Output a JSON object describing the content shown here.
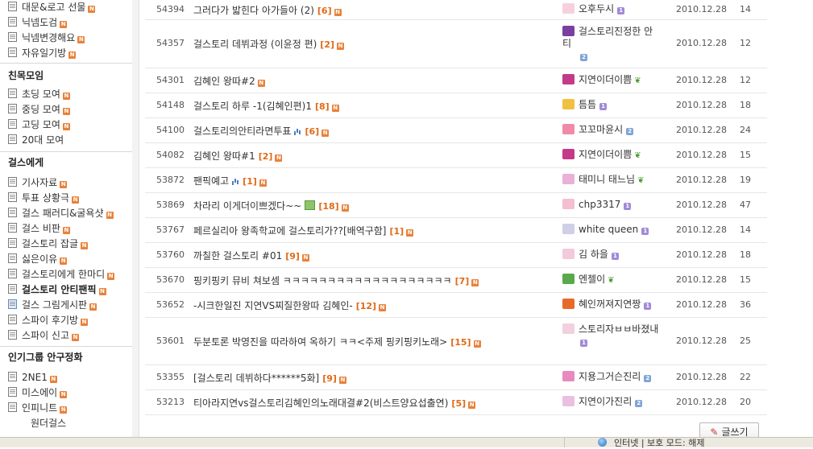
{
  "sidebar": {
    "group1_items": [
      {
        "label": "대문&로고 선물",
        "badge": "N"
      },
      {
        "label": "닉넴도검",
        "badge": "N"
      },
      {
        "label": "닉넴변경해요",
        "badge": "N"
      },
      {
        "label": "자유일기방",
        "badge": "N"
      }
    ],
    "group2_title": "친목모임",
    "group2_items": [
      {
        "label": "초딩 모여",
        "badge": "N"
      },
      {
        "label": "중딩 모여",
        "badge": "N"
      },
      {
        "label": "고딩 모여",
        "badge": "N"
      },
      {
        "label": "20대 모여",
        "badge": ""
      }
    ],
    "group3_title": "걸스에게",
    "group3_items": [
      {
        "label": "기사자료",
        "badge": "N"
      },
      {
        "label": "투표 상황극",
        "badge": "N"
      },
      {
        "label": "걸스 패러디&굴욕샷",
        "badge": "N"
      },
      {
        "label": "걸스 비판",
        "badge": "N"
      },
      {
        "label": "걸스토리 잡글",
        "badge": "N"
      },
      {
        "label": "싫은이유",
        "badge": "N"
      },
      {
        "label": "걸스토리에게 한마디",
        "badge": "N"
      },
      {
        "label": "걸스토리 안티팬픽",
        "badge": "N"
      },
      {
        "label": "걸스 그림게시판",
        "badge": "N"
      },
      {
        "label": "스파이 후기방",
        "badge": "N"
      },
      {
        "label": "스파이 신고",
        "badge": "N"
      }
    ],
    "group4_title": "인기그룹 안구정화",
    "group4_items": [
      {
        "label": "2NE1",
        "badge": "N"
      },
      {
        "label": "미스에이",
        "badge": "N"
      },
      {
        "label": "인피니트",
        "badge": "N"
      },
      {
        "label": "원더걸스",
        "badge": ""
      }
    ]
  },
  "posts": [
    {
      "num": "54394",
      "title": "그러다가 밟힌다 아가들아 (2)",
      "count": "[6]",
      "extra": "",
      "author": "오후두시",
      "level": "1",
      "sprout": false,
      "date": "2010.12.28",
      "views": "14"
    },
    {
      "num": "54357",
      "title": "걸스토리 데뷔과정 (이윤정 편)",
      "count": "[2]",
      "extra": "",
      "author": "걸스토리진정한 안티",
      "level": "2",
      "sprout": false,
      "date": "2010.12.28",
      "views": "12"
    },
    {
      "num": "54301",
      "title": "김혜인 왕따#2",
      "count": "",
      "extra": "",
      "author": "지연이더이쁨",
      "level": "",
      "sprout": true,
      "date": "2010.12.28",
      "views": "12"
    },
    {
      "num": "54148",
      "title": "걸스토리 하루 -1(김혜인편)1",
      "count": "[8]",
      "extra": "",
      "author": "틈틈",
      "level": "1",
      "sprout": false,
      "date": "2010.12.28",
      "views": "18"
    },
    {
      "num": "54100",
      "title": "걸스토리의안티라면투표",
      "count": "[6]",
      "extra": "poll",
      "author": "꼬꼬마윤시",
      "level": "2",
      "sprout": false,
      "date": "2010.12.28",
      "views": "24"
    },
    {
      "num": "54082",
      "title": "김혜인 왕따#1",
      "count": "[2]",
      "extra": "",
      "author": "지연이더이쁨",
      "level": "",
      "sprout": true,
      "date": "2010.12.28",
      "views": "15"
    },
    {
      "num": "53872",
      "title": "팬픽예고",
      "count": "[1]",
      "extra": "poll",
      "author": "태미니 태느님",
      "level": "",
      "sprout": true,
      "date": "2010.12.28",
      "views": "19"
    },
    {
      "num": "53869",
      "title": "차라리 이게더이쁘겠다~~",
      "count": "[18]",
      "extra": "image",
      "author": "chp3317",
      "level": "1",
      "sprout": false,
      "date": "2010.12.28",
      "views": "47"
    },
    {
      "num": "53767",
      "title": "페르실리아 왕족학교에 걸스토리가??[배역구함]",
      "count": "[1]",
      "extra": "",
      "author": "white queen",
      "level": "1",
      "sprout": false,
      "date": "2010.12.28",
      "views": "14"
    },
    {
      "num": "53760",
      "title": "까칠한 걸스토리 #01",
      "count": "[9]",
      "extra": "",
      "author": "김 하을",
      "level": "1",
      "sprout": false,
      "date": "2010.12.28",
      "views": "18"
    },
    {
      "num": "53670",
      "title": "핑키핑키 뮤비 쳐보셈 ㅋㅋㅋㅋㅋㅋㅋㅋㅋㅋㅋㅋㅋㅋㅋㅋㅋㅋㅋ",
      "count": "[7]",
      "extra": "",
      "author": "엔젤이",
      "level": "",
      "sprout": true,
      "date": "2010.12.28",
      "views": "15"
    },
    {
      "num": "53652",
      "title": "-시크한일진 지연VS찌질한왕따 김혜인-",
      "count": "[12]",
      "extra": "",
      "author": "혜인꺼져지연짱",
      "level": "1",
      "sprout": false,
      "date": "2010.12.28",
      "views": "36"
    },
    {
      "num": "53601",
      "title": "두분토론 박영진을 따라하여 옥하기 ㅋㅋ<주제 핑키핑키노래>",
      "count": "[15]",
      "extra": "",
      "author": "스토리자ㅂㅂ바졌내",
      "level": "1",
      "sprout": false,
      "date": "2010.12.28",
      "views": "25"
    },
    {
      "num": "53355",
      "title": "[걸스토리 데뷔하다******5화]",
      "count": "[9]",
      "extra": "",
      "author": "지용그거슨진리",
      "level": "2",
      "sprout": false,
      "date": "2010.12.28",
      "views": "22"
    },
    {
      "num": "53213",
      "title": "티아라지연vs걸스토리김혜인의노래대결#2(비스트양요섭출연)",
      "count": "[5]",
      "extra": "",
      "author": "지연이가진리",
      "level": "2",
      "sprout": false,
      "date": "2010.12.28",
      "views": "20"
    }
  ],
  "write_button": "글쓰기",
  "statusbar": {
    "zone": "인터넷 | 보호 모드: 해제"
  },
  "colors": {
    "badge": "#e8823a",
    "count": "#e06a17",
    "level1": "#a08ad8",
    "level2": "#7fa4d8"
  }
}
